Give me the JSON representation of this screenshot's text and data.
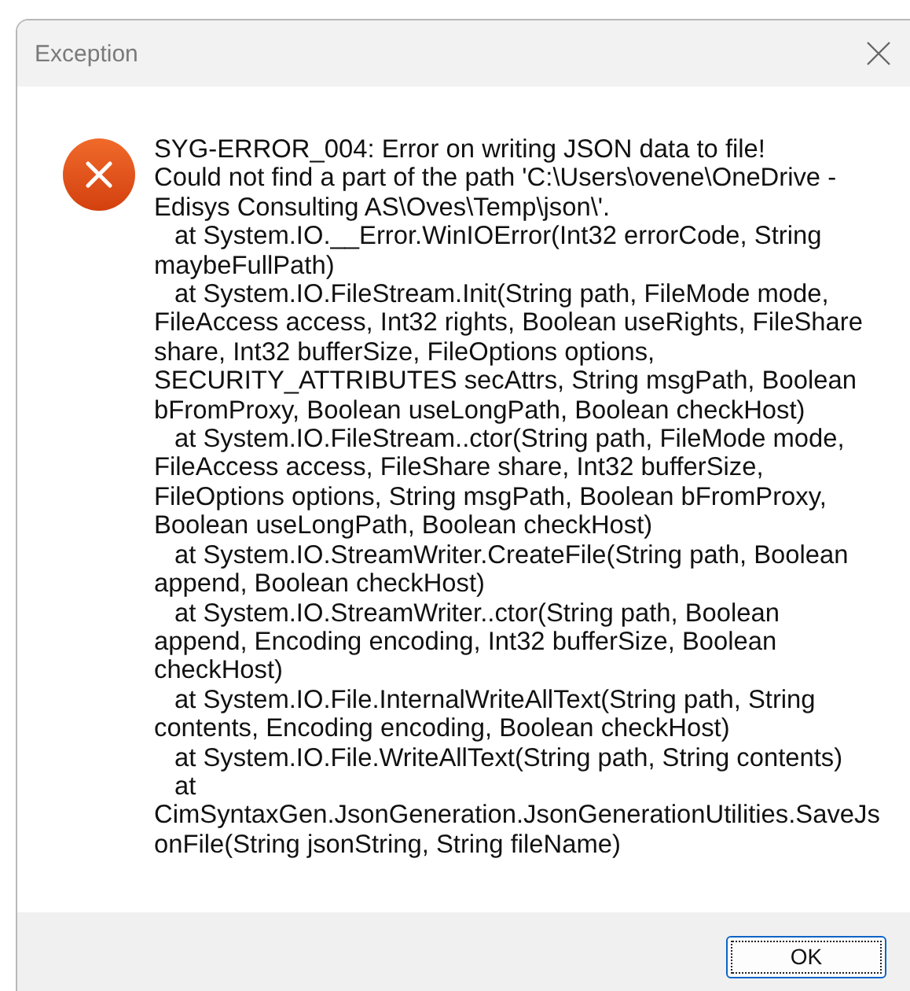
{
  "window": {
    "title": "Exception"
  },
  "message": {
    "lines": [
      {
        "text": "SYG-ERROR_004: Error on writing JSON data to file!",
        "indented": false
      },
      {
        "text": "Could not find a part of the path 'C:\\Users\\ovene\\OneDrive -",
        "indented": false
      },
      {
        "text": "Edisys Consulting AS\\Oves\\Temp\\json\\'.",
        "indented": false
      },
      {
        "text": "at System.IO.__Error.WinIOError(Int32 errorCode, String",
        "indented": true
      },
      {
        "text": "maybeFullPath)",
        "indented": false
      },
      {
        "text": "at System.IO.FileStream.Init(String path, FileMode mode,",
        "indented": true
      },
      {
        "text": "FileAccess access, Int32 rights, Boolean useRights, FileShare",
        "indented": false
      },
      {
        "text": "share, Int32 bufferSize, FileOptions options,",
        "indented": false
      },
      {
        "text": "SECURITY_ATTRIBUTES secAttrs, String msgPath, Boolean",
        "indented": false
      },
      {
        "text": "bFromProxy, Boolean useLongPath, Boolean checkHost)",
        "indented": false
      },
      {
        "text": "at System.IO.FileStream..ctor(String path, FileMode mode,",
        "indented": true
      },
      {
        "text": "FileAccess access, FileShare share, Int32 bufferSize,",
        "indented": false
      },
      {
        "text": "FileOptions options, String msgPath, Boolean bFromProxy,",
        "indented": false
      },
      {
        "text": "Boolean useLongPath, Boolean checkHost)",
        "indented": false
      },
      {
        "text": "at System.IO.StreamWriter.CreateFile(String path, Boolean",
        "indented": true
      },
      {
        "text": "append, Boolean checkHost)",
        "indented": false
      },
      {
        "text": "at System.IO.StreamWriter..ctor(String path, Boolean",
        "indented": true
      },
      {
        "text": "append, Encoding encoding, Int32 bufferSize, Boolean",
        "indented": false
      },
      {
        "text": "checkHost)",
        "indented": false
      },
      {
        "text": "at System.IO.File.InternalWriteAllText(String path, String",
        "indented": true
      },
      {
        "text": "contents, Encoding encoding, Boolean checkHost)",
        "indented": false
      },
      {
        "text": "at System.IO.File.WriteAllText(String path, String contents)",
        "indented": true
      },
      {
        "text": "at",
        "indented": true
      },
      {
        "text": "CimSyntaxGen.JsonGeneration.JsonGenerationUtilities.SaveJs",
        "indented": false
      },
      {
        "text": "onFile(String jsonString, String fileName)",
        "indented": false
      }
    ]
  },
  "buttons": [
    {
      "label": "OK",
      "focused": true
    }
  ]
}
